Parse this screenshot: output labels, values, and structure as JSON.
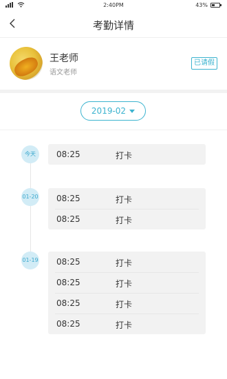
{
  "status_bar": {
    "time": "2:40PM",
    "battery_percent": "43%",
    "battery_level": 0.43,
    "icons": [
      "signal-icon",
      "wifi-icon",
      "battery-icon"
    ]
  },
  "nav": {
    "title": "考勤详情",
    "back_icon": "chevron-left-icon"
  },
  "profile": {
    "name": "王老师",
    "subject": "语文老师",
    "badge": "已请假",
    "accent_color": "#3bb3cf"
  },
  "month_selector": {
    "value": "2019-02",
    "icon": "caret-down-icon"
  },
  "days": [
    {
      "date": "今天",
      "records": [
        {
          "time": "08:25",
          "action": "打卡"
        }
      ]
    },
    {
      "date": "01-20",
      "records": [
        {
          "time": "08:25",
          "action": "打卡"
        },
        {
          "time": "08:25",
          "action": "打卡"
        }
      ]
    },
    {
      "date": "01-19",
      "records": [
        {
          "time": "08:25",
          "action": "打卡"
        },
        {
          "time": "08:25",
          "action": "打卡"
        },
        {
          "time": "08:25",
          "action": "打卡"
        },
        {
          "time": "08:25",
          "action": "打卡"
        }
      ]
    }
  ]
}
